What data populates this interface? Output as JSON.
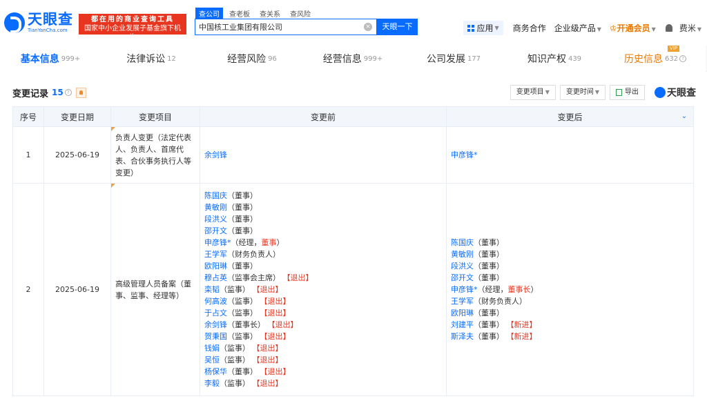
{
  "brand": {
    "name_cn": "天眼查",
    "name_en": "TianYanCha.com",
    "slogan_line1": "都在用的商业查询工具",
    "slogan_line2": "国家中小企业发展子基金旗下机构"
  },
  "search": {
    "tabs": [
      "查公司",
      "查老板",
      "查关系",
      "查风险"
    ],
    "active_tab": 0,
    "value": "中国核工业集团有限公司",
    "button": "天眼一下",
    "clear_icon": "close-circle-icon"
  },
  "nav": {
    "app": "应用",
    "business": "商务合作",
    "enterprise": "企业级产品",
    "vip": "开通会员",
    "user": "费米"
  },
  "subtabs": [
    {
      "label": "基本信息",
      "count": "999+"
    },
    {
      "label": "法律诉讼",
      "count": "12"
    },
    {
      "label": "经营风险",
      "count": "96"
    },
    {
      "label": "经营信息",
      "count": "999+"
    },
    {
      "label": "公司发展",
      "count": "177"
    },
    {
      "label": "知识产权",
      "count": "439"
    },
    {
      "label": "历史信息",
      "count": "632",
      "tag": "VIP"
    }
  ],
  "section": {
    "title": "变更记录",
    "count": "15",
    "filter_item": "变更项目",
    "filter_time": "变更时间",
    "export": "导出",
    "brand_small": "天眼查"
  },
  "table": {
    "headers": [
      "序号",
      "变更日期",
      "变更项目",
      "变更前",
      "变更后"
    ],
    "rows": [
      {
        "index": "1",
        "date": "2025-06-19",
        "item": "负责人变更（法定代表人、负责人、首席代表、合伙事务执行人等变更）",
        "before": [
          {
            "name": "余剑锋",
            "role": "",
            "tag": ""
          }
        ],
        "after": [
          {
            "name": "申彦锋*",
            "role": "",
            "tag": ""
          }
        ]
      },
      {
        "index": "2",
        "date": "2025-06-19",
        "item": "高级管理人员备案（董事、监事、经理等）",
        "before": [
          {
            "name": "陈国庆",
            "role": "（董事）",
            "tag": ""
          },
          {
            "name": "黄敏刚",
            "role": "（董事）",
            "tag": ""
          },
          {
            "name": "段洪义",
            "role": "（董事）",
            "tag": ""
          },
          {
            "name": "邵开文",
            "role": "（董事）",
            "tag": ""
          },
          {
            "name": "申彦锋*",
            "role": "（经理，",
            "role_hl": "董事",
            "role_end": "）",
            "tag": ""
          },
          {
            "name": "王学军",
            "role": "（财务负责人）",
            "tag": ""
          },
          {
            "name": "欧阳琳",
            "role": "（董事）",
            "tag": ""
          },
          {
            "name": "穆占英",
            "role": "（监事会主席）",
            "tag": "【退出】"
          },
          {
            "name": "栾韬",
            "role": "（监事）",
            "tag": "【退出】"
          },
          {
            "name": "何高波",
            "role": "（监事）",
            "tag": "【退出】"
          },
          {
            "name": "于占文",
            "role": "（监事）",
            "tag": "【退出】"
          },
          {
            "name": "余剑锋",
            "role": "（董事长）",
            "tag": "【退出】"
          },
          {
            "name": "贺秉国",
            "role": "（监事）",
            "tag": "【退出】"
          },
          {
            "name": "钱娟",
            "role": "（监事）",
            "tag": "【退出】"
          },
          {
            "name": "吴恒",
            "role": "（监事）",
            "tag": "【退出】"
          },
          {
            "name": "杨保华",
            "role": "（董事）",
            "tag": "【退出】"
          },
          {
            "name": "李毅",
            "role": "（监事）",
            "tag": "【退出】"
          }
        ],
        "after": [
          {
            "name": "陈国庆",
            "role": "（董事）",
            "tag": ""
          },
          {
            "name": "黄敏刚",
            "role": "（董事）",
            "tag": ""
          },
          {
            "name": "段洪义",
            "role": "（董事）",
            "tag": ""
          },
          {
            "name": "邵开文",
            "role": "（董事）",
            "tag": ""
          },
          {
            "name": "申彦锋*",
            "role": "（经理，",
            "role_hl": "董事长",
            "role_end": "）",
            "tag": ""
          },
          {
            "name": "王学军",
            "role": "（财务负责人）",
            "tag": ""
          },
          {
            "name": "欧阳琳",
            "role": "（董事）",
            "tag": ""
          },
          {
            "name": "刘建平",
            "role": "（董事）",
            "tag": "【新进】"
          },
          {
            "name": "斯泽夫",
            "role": "（董事）",
            "tag": "【新进】"
          }
        ]
      }
    ]
  }
}
